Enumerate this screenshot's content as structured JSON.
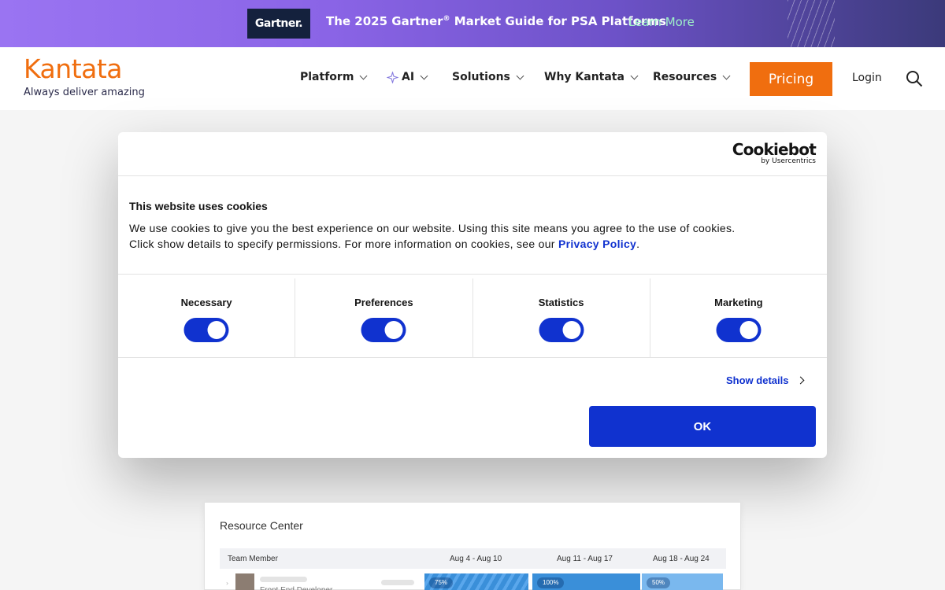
{
  "banner": {
    "logo": "Gartner.",
    "headline_pre": "The 2025 Gartner",
    "headline_sup": "®",
    "headline_post": " Market Guide for PSA Platforms",
    "link": "Learn More"
  },
  "header": {
    "logo": "Kantata",
    "tagline": "Always deliver amazing",
    "nav": [
      {
        "label": "Platform"
      },
      {
        "label": "AI"
      },
      {
        "label": "Solutions"
      },
      {
        "label": "Why Kantata"
      },
      {
        "label": "Resources"
      }
    ],
    "pricing": "Pricing",
    "login": "Login",
    "search_icon": "search-icon"
  },
  "cookie_dialog": {
    "brand": "Cookiebot",
    "brand_sub": "by Usercentrics",
    "title": "This website uses cookies",
    "text_before": "We use cookies to give you the best experience on our website. Using this site means you agree to the use of cookies. Click show details to specify permissions. For more information on cookies, see our ",
    "link": "Privacy Policy",
    "text_after": ".",
    "categories": [
      {
        "label": "Necessary",
        "enabled": true
      },
      {
        "label": "Preferences",
        "enabled": true
      },
      {
        "label": "Statistics",
        "enabled": true
      },
      {
        "label": "Marketing",
        "enabled": true
      }
    ],
    "show_details": "Show details",
    "ok": "OK"
  },
  "preview": {
    "title": "Resource Center",
    "columns": [
      "Team Member",
      "Aug 4 - Aug 10",
      "Aug 11 - Aug 17",
      "Aug 18 - Aug 24"
    ],
    "row": {
      "role": "Front End Developer",
      "allocations": [
        "75%",
        "100%",
        "50%"
      ]
    }
  },
  "colors": {
    "brand_orange": "#f06e0f",
    "cookie_blue": "#1032cf",
    "banner_purple": "#9a74f2"
  }
}
